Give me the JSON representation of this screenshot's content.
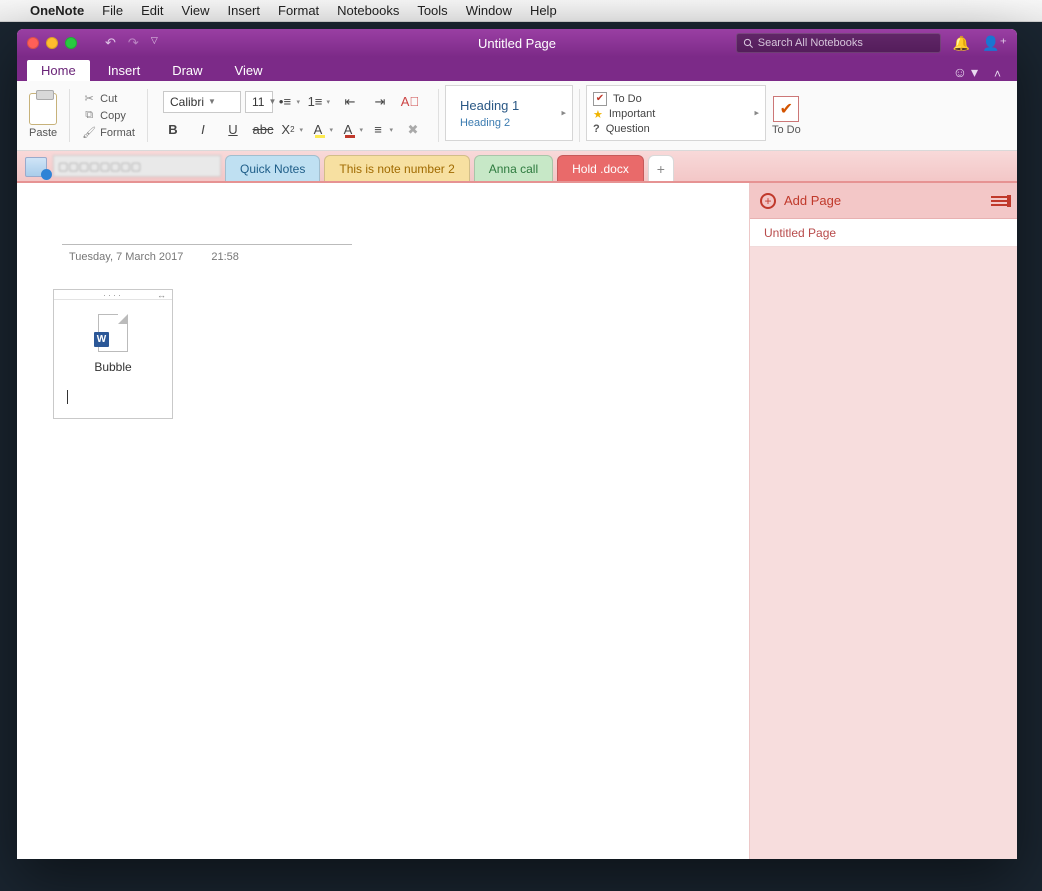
{
  "mac_menu": {
    "app": "OneNote",
    "items": [
      "File",
      "Edit",
      "View",
      "Insert",
      "Format",
      "Notebooks",
      "Tools",
      "Window",
      "Help"
    ]
  },
  "window": {
    "title": "Untitled Page",
    "search_placeholder": "Search All Notebooks"
  },
  "ribbon_tabs": [
    "Home",
    "Insert",
    "Draw",
    "View"
  ],
  "ribbon_active_tab": "Home",
  "ribbon": {
    "paste": "Paste",
    "cut": "Cut",
    "copy": "Copy",
    "format": "Format",
    "font_name": "Calibri",
    "font_size": "11",
    "styles": {
      "h1": "Heading 1",
      "h2": "Heading 2"
    },
    "tags": {
      "todo": "To Do",
      "important": "Important",
      "question": "Question"
    },
    "todo_label": "To Do"
  },
  "section_tabs": [
    {
      "label": "Quick Notes",
      "color": "blue"
    },
    {
      "label": "This is note number 2",
      "color": "yellow"
    },
    {
      "label": "Anna call",
      "color": "green"
    },
    {
      "label": "Hold .docx",
      "color": "red",
      "active": true
    }
  ],
  "page": {
    "date": "Tuesday, 7 March 2017",
    "time": "21:58",
    "embed_caption": "Bubble"
  },
  "pagelist": {
    "add_page": "Add Page",
    "items": [
      "Untitled Page"
    ]
  }
}
